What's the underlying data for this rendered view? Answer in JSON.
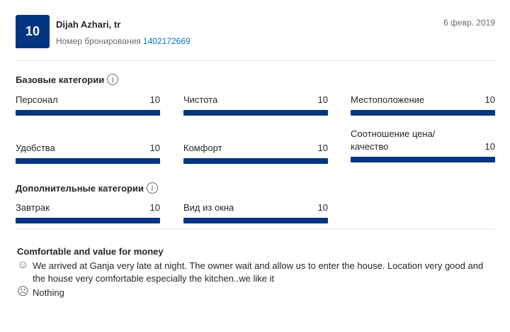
{
  "review": {
    "score": "10",
    "guest": "Dijah Azhari, tr",
    "booking_label": "Номер бронирования",
    "booking_number": "1402172669",
    "date": "6 февр. 2019"
  },
  "base_categories": {
    "title": "Базовые категории",
    "items": [
      {
        "label": "Персонал",
        "score": "10",
        "fraction": 1.0
      },
      {
        "label": "Чистота",
        "score": "10",
        "fraction": 1.0
      },
      {
        "label": "Местоположение",
        "score": "10",
        "fraction": 1.0
      },
      {
        "label": "Удобства",
        "score": "10",
        "fraction": 1.0
      },
      {
        "label": "Комфорт",
        "score": "10",
        "fraction": 1.0
      },
      {
        "label": "Соотношение цена/ качество",
        "score": "10",
        "fraction": 1.0
      }
    ]
  },
  "extra_categories": {
    "title": "Дополнительные категории",
    "items": [
      {
        "label": "Завтрак",
        "score": "10",
        "fraction": 1.0
      },
      {
        "label": "Вид из окна",
        "score": "10",
        "fraction": 1.0
      }
    ]
  },
  "review_text": {
    "title": "Comfortable and value for money",
    "positive": "We arrived at Ganja very late at night. The owner wait and allow us to enter the house. Location very good and the house very comfortable especially the kitchen..we like it",
    "negative": "Nothing"
  },
  "icons": {
    "info": "info-icon",
    "positive": "smile-face-icon",
    "negative": "sad-face-icon"
  },
  "colors": {
    "brand": "#003580",
    "link": "#0071c2"
  }
}
